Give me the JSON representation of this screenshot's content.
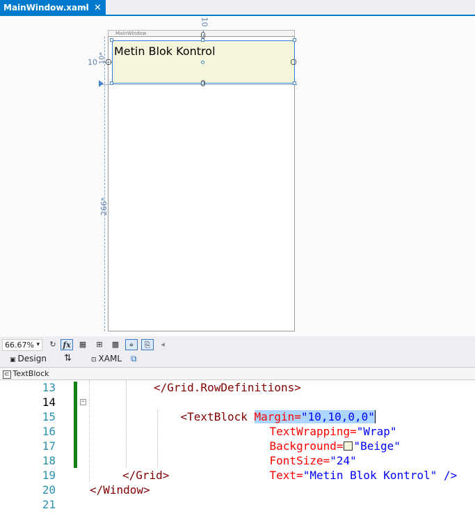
{
  "tab": {
    "title": "MainWindow.xaml",
    "pin": "⊣",
    "close": "✕"
  },
  "designer": {
    "window_title": "MainWindow",
    "textblock_text": "Metin Blok Kontrol",
    "top_margin_label": "10",
    "left_margin_label": "10",
    "row1_label": "10*",
    "row2_label": "266*",
    "bulb": "💡",
    "bulb_arrow": "▸"
  },
  "toolbar": {
    "zoom": "66.67%",
    "zoom_arrow": "▾",
    "refresh": "↻",
    "fx": "fx",
    "grid": "▦",
    "layout": "⊞",
    "checker": "▩",
    "snap": "⌖",
    "snap2": "⎘",
    "collapse": "◂"
  },
  "view_tabs": {
    "design": "Design",
    "swap": "⇅",
    "xaml": "XAML",
    "popout": "⧉"
  },
  "breadcrumb": {
    "label": "TextBlock"
  },
  "code": {
    "line_numbers": [
      "13",
      "14",
      "15",
      "16",
      "17",
      "18",
      "19",
      "20",
      "21"
    ],
    "l13": "</Grid.RowDefinitions>",
    "l14_tag": "<TextBlock ",
    "l14_attr": "Margin=",
    "l14_val": "\"10,10,0,0\"",
    "l15_attr": "TextWrapping=",
    "l15_val": "\"Wrap\"",
    "l16_attr": "Background=",
    "l16_val": "\"Beige\"",
    "l17_attr": "FontSize=",
    "l17_val": "\"24\"",
    "l18_attr": "Text=",
    "l18_val": "\"Metin Blok Kontrol\"",
    "l18_end": " />",
    "l19": "</Grid>",
    "l20": "</Window>"
  },
  "colors": {
    "accent": "#007acc",
    "tag": "#800000",
    "attr": "#ff0000",
    "value": "#0000ff",
    "beige": "#f5f5dc"
  }
}
